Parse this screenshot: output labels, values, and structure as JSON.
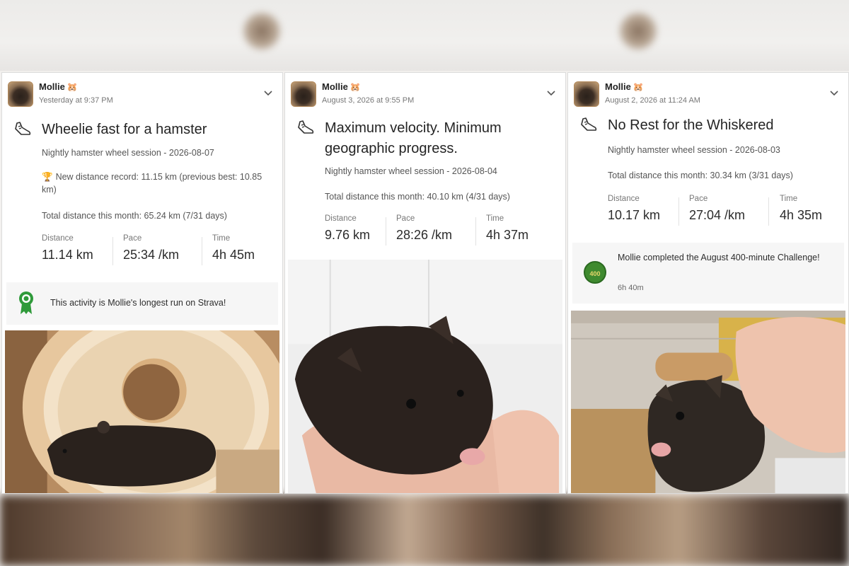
{
  "cards": [
    {
      "user": "Mollie",
      "badge": "🐹",
      "timestamp": "Yesterday at 9:37 PM",
      "title": "Wheelie fast for a hamster",
      "session": "Nightly hamster wheel session - 2026-08-07",
      "record": "New distance record: 11.15 km (previous best: 10.85 km)",
      "month_total": "Total distance this month: 65.24 km (7/31 days)",
      "stats": [
        {
          "label": "Distance",
          "value": "11.14 km"
        },
        {
          "label": "Pace",
          "value": "25:34 /km"
        },
        {
          "label": "Time",
          "value": "4h 45m"
        }
      ],
      "banner": "This activity is Mollie's longest run on Strava!"
    },
    {
      "user": "Mollie",
      "badge": "🐹",
      "timestamp": "August 3, 2026 at 9:55 PM",
      "title": "Maximum velocity. Minimum geographic progress.",
      "session": "Nightly hamster wheel session - 2026-08-04",
      "month_total": "Total distance this month: 40.10 km (4/31 days)",
      "stats": [
        {
          "label": "Distance",
          "value": "9.76 km"
        },
        {
          "label": "Pace",
          "value": "28:26 /km"
        },
        {
          "label": "Time",
          "value": "4h 37m"
        }
      ]
    },
    {
      "user": "Mollie",
      "badge": "🐹",
      "timestamp": "August 2, 2026 at 11:24 AM",
      "title": "No Rest for the Whiskered",
      "session": "Nightly hamster wheel session - 2026-08-03",
      "month_total": "Total distance this month: 30.34 km (3/31 days)",
      "stats": [
        {
          "label": "Distance",
          "value": "10.17 km"
        },
        {
          "label": "Pace",
          "value": "27:04 /km"
        },
        {
          "label": "Time",
          "value": "4h 35m"
        }
      ],
      "challenge": "Mollie completed the August 400-minute Challenge!",
      "challenge_time": "6h 40m",
      "challenge_badge": "400"
    }
  ],
  "icons": {
    "shoe": "running-shoe-icon",
    "chevron": "chevron-down-icon",
    "trophy": "🏆",
    "ribbon": "achievement-ribbon-icon"
  },
  "colors": {
    "ribbon_green": "#2f9a3a",
    "challenge_badge": "#3f8a2f"
  }
}
